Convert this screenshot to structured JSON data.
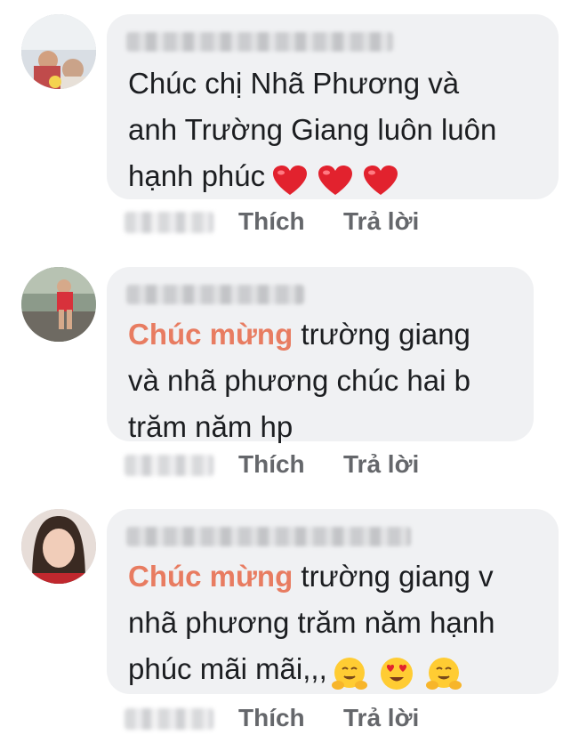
{
  "comments": [
    {
      "lines": [
        "Chúc chị Nhã Phương và",
        "anh Trường Giang luôn luôn",
        "hạnh phúc"
      ],
      "emojis": [
        "red-heart",
        "red-heart",
        "red-heart"
      ],
      "actions": {
        "like": "Thích",
        "reply": "Trả lời"
      }
    },
    {
      "highlight": "Chúc mừng",
      "lines": [
        " trường giang",
        "và nhã phương chúc hai b",
        "trăm năm hp"
      ],
      "actions": {
        "like": "Thích",
        "reply": "Trả lời"
      }
    },
    {
      "highlight": "Chúc mừng",
      "lines": [
        " trường giang v",
        "nhã phương trăm năm hạnh",
        "phúc mãi mãi,,,"
      ],
      "emojis": [
        "hugging-face",
        "heart-eyes-face",
        "hugging-face"
      ],
      "actions": {
        "like": "Thích",
        "reply": "Trả lời"
      }
    }
  ],
  "colors": {
    "highlight": "#e87c61",
    "bubble": "#f0f1f3",
    "action": "#65676b"
  }
}
